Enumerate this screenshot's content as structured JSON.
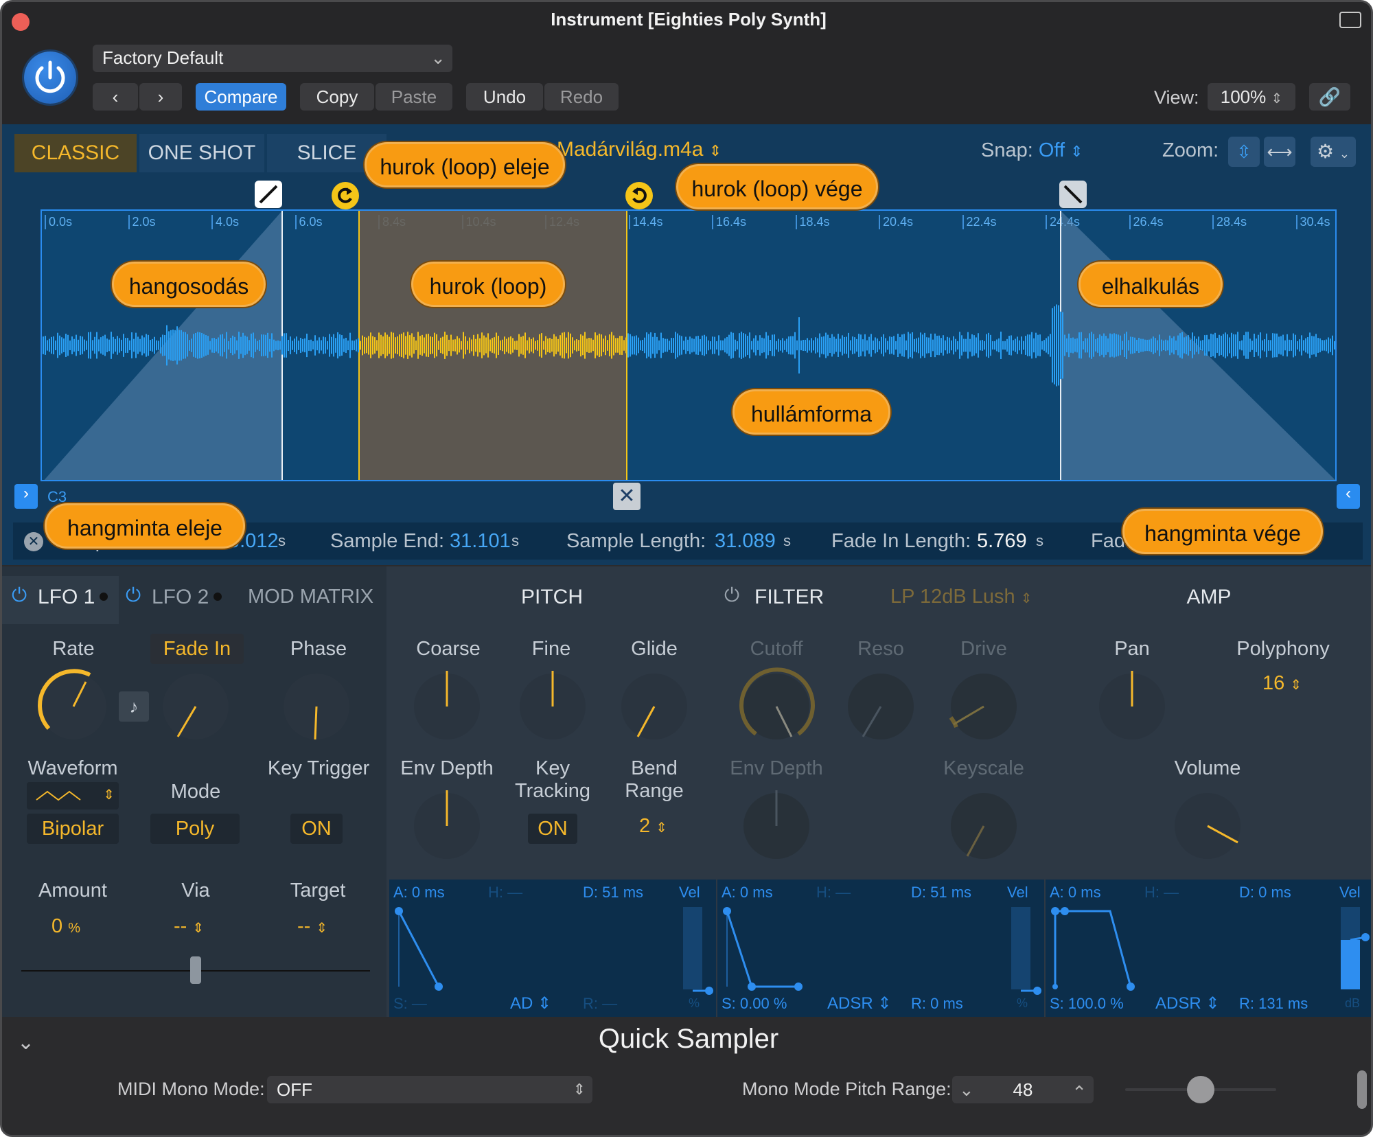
{
  "window": {
    "title": "Instrument [Eighties Poly Synth]"
  },
  "toolbar": {
    "preset": "Factory Default",
    "prev": "‹",
    "next": "›",
    "compare": "Compare",
    "copy": "Copy",
    "paste": "Paste",
    "undo": "Undo",
    "redo": "Redo",
    "view_label": "View:",
    "view_value": "100%"
  },
  "modes": {
    "classic": "CLASSIC",
    "one_shot": "ONE SHOT",
    "slice": "SLICE"
  },
  "file": {
    "name": "Madárvilág.m4a"
  },
  "snap": {
    "label": "Snap:",
    "value": "Off"
  },
  "zoom": {
    "label": "Zoom:"
  },
  "ruler": [
    "0.0s",
    "2.0s",
    "4.0s",
    "6.0s",
    "8.4s",
    "10.4s",
    "12.4s",
    "14.4s",
    "16.4s",
    "18.4s",
    "20.4s",
    "22.4s",
    "24.4s",
    "26.4s",
    "28.4s",
    "30.4s"
  ],
  "root_note": "C3",
  "info": {
    "start_label": "Sample Start:",
    "start_value": "0.012",
    "unit": "s",
    "end_label": "Sample End:",
    "end_value": "31.101",
    "length_label": "Sample Length:",
    "length_value": "31.089",
    "fade_label": "Fade In Length:",
    "fade_value": "5.769",
    "fade_out_label": "Fad"
  },
  "callouts": {
    "loop_start": "hurok (loop) eleje",
    "loop_end": "hurok (loop) vége",
    "fade_in": "hangosodás",
    "loop": "hurok (loop)",
    "fade_out": "elhalkulás",
    "waveform": "hullámforma",
    "sample_start": "hangminta eleje",
    "sample_end": "hangminta vége"
  },
  "lfo": {
    "tab1": "LFO 1",
    "tab2": "LFO 2",
    "tab3": "MOD MATRIX",
    "rate": "Rate",
    "fade_in": "Fade In",
    "phase": "Phase",
    "waveform": "Waveform",
    "mode": "Mode",
    "key_trigger": "Key Trigger",
    "bipolar": "Bipolar",
    "poly": "Poly",
    "on": "ON",
    "amount": "Amount",
    "amount_value": "0",
    "amount_unit": "%",
    "via": "Via",
    "via_value": "--",
    "target": "Target",
    "target_value": "--"
  },
  "pitch": {
    "title": "PITCH",
    "coarse": "Coarse",
    "fine": "Fine",
    "glide": "Glide",
    "env_depth": "Env Depth",
    "key_tracking": "Key Tracking",
    "bend_range": "Bend Range",
    "key_tracking_value": "ON",
    "bend_value": "2",
    "env": {
      "a": "A: 0 ms",
      "h": "H: —",
      "d": "D: 51 ms",
      "vel": "Vel",
      "s": "S: —",
      "mode": "AD",
      "r": "R: —",
      "unit": "%"
    }
  },
  "filter": {
    "title": "FILTER",
    "type": "LP 12dB Lush",
    "cutoff": "Cutoff",
    "reso": "Reso",
    "drive": "Drive",
    "env_depth": "Env Depth",
    "keyscale": "Keyscale",
    "env": {
      "a": "A: 0 ms",
      "h": "H: —",
      "d": "D: 51 ms",
      "vel": "Vel",
      "s": "S: 0.00 %",
      "mode": "ADSR",
      "r": "R: 0 ms",
      "unit": "%"
    }
  },
  "amp": {
    "title": "AMP",
    "pan": "Pan",
    "polyphony": "Polyphony",
    "polyphony_value": "16",
    "volume": "Volume",
    "env": {
      "a": "A: 0 ms",
      "h": "H: —",
      "d": "D: 0 ms",
      "vel": "Vel",
      "s": "S: 100.0 %",
      "mode": "ADSR",
      "r": "R: 131 ms",
      "unit": "dB"
    }
  },
  "footer": {
    "plugin": "Quick Sampler",
    "mono_label": "MIDI Mono Mode:",
    "mono_value": "OFF",
    "pitch_range_label": "Mono Mode Pitch Range:",
    "pitch_range_value": "48"
  },
  "colors": {
    "accent": "#f5b82b",
    "blue": "#2f7ed8",
    "callout": "#f89b12"
  }
}
